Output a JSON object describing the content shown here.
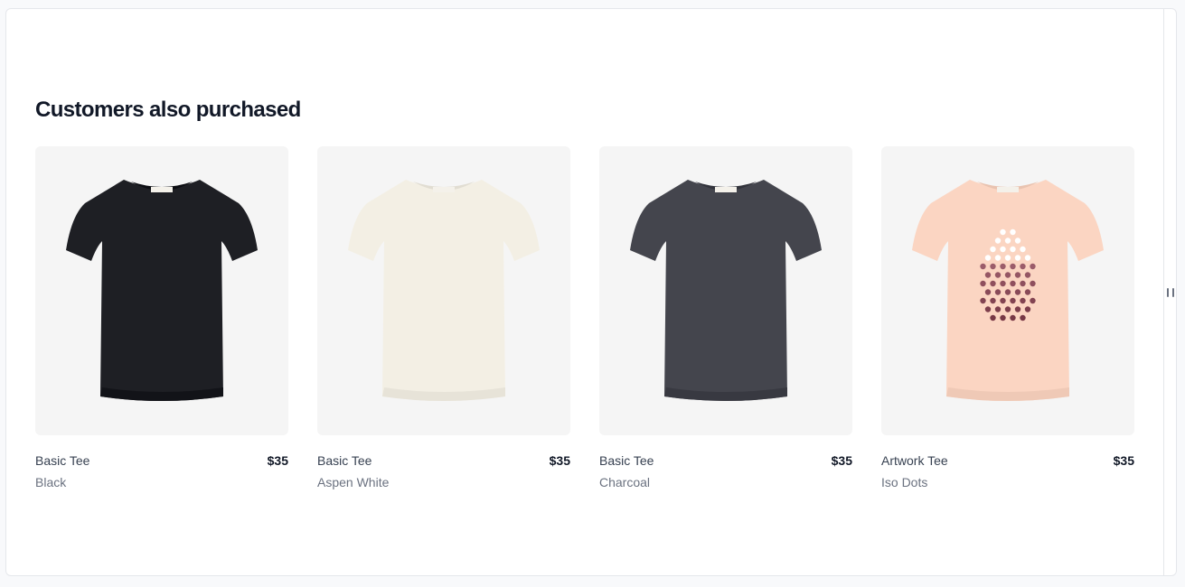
{
  "section": {
    "title": "Customers also purchased"
  },
  "products": [
    {
      "name": "Basic Tee",
      "color": "Black",
      "price": "$35",
      "shirt_color": "#1e1f24",
      "print": "none",
      "image_icon": "black-t-shirt-icon"
    },
    {
      "name": "Basic Tee",
      "color": "Aspen White",
      "price": "$35",
      "shirt_color": "#f3efe4",
      "print": "none",
      "image_icon": "white-t-shirt-icon"
    },
    {
      "name": "Basic Tee",
      "color": "Charcoal",
      "price": "$35",
      "shirt_color": "#44454d",
      "print": "none",
      "image_icon": "charcoal-t-shirt-icon"
    },
    {
      "name": "Artwork Tee",
      "color": "Iso Dots",
      "price": "$35",
      "shirt_color": "#fbd5c2",
      "print": "iso-dots",
      "image_icon": "peach-dotted-t-shirt-icon"
    }
  ],
  "colors": {
    "heading": "#111827",
    "name_text": "#374151",
    "secondary_text": "#6b7280",
    "image_bg": "#f5f5f5"
  }
}
